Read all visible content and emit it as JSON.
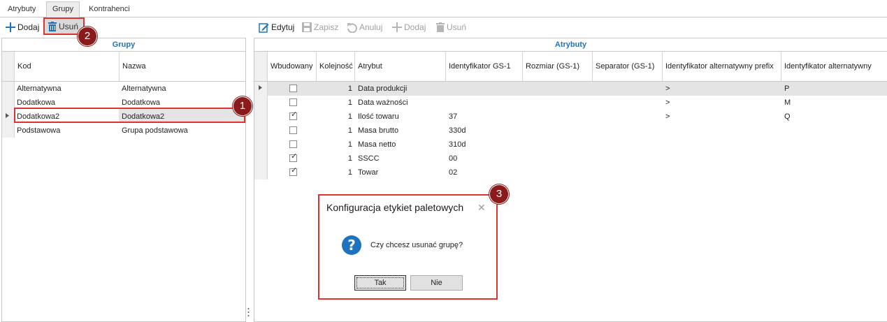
{
  "tabs": [
    "Atrybuty",
    "Grupy",
    "Kontrahenci"
  ],
  "left_toolbar": {
    "add": "Dodaj",
    "delete": "Usuń"
  },
  "right_toolbar": {
    "edit": "Edytuj",
    "save": "Zapisz",
    "cancel": "Anuluj",
    "add": "Dodaj",
    "delete": "Usuń"
  },
  "groups_panel": {
    "title": "Grupy",
    "columns": [
      "Kod",
      "Nazwa"
    ],
    "rows": [
      {
        "kod": "Alternatywna",
        "nazwa": "Alternatywna"
      },
      {
        "kod": "Dodatkowa",
        "nazwa": "Dodatkowa"
      },
      {
        "kod": "Dodatkowa2",
        "nazwa": "Dodatkowa2"
      },
      {
        "kod": "Podstawowa",
        "nazwa": "Grupa podstawowa"
      }
    ],
    "selected_index": 2
  },
  "attributes_panel": {
    "title": "Atrybuty",
    "columns": [
      "Wbudowany",
      "Kolejność",
      "Atrybut",
      "Identyfikator GS-1",
      "Rozmiar (GS-1)",
      "Separator (GS-1)",
      "Identyfikator alternatywny prefix",
      "Identyfikator alternatywny"
    ],
    "rows": [
      {
        "wbudowany": false,
        "kolejnosc": "1",
        "atrybut": "Data produkcji",
        "gs1": "",
        "rozmiar": "",
        "separator": "",
        "alt_prefix": ">",
        "alt": "P"
      },
      {
        "wbudowany": false,
        "kolejnosc": "1",
        "atrybut": "Data ważności",
        "gs1": "",
        "rozmiar": "",
        "separator": "",
        "alt_prefix": ">",
        "alt": "M"
      },
      {
        "wbudowany": true,
        "kolejnosc": "1",
        "atrybut": "Ilość towaru",
        "gs1": "37",
        "rozmiar": "",
        "separator": "",
        "alt_prefix": ">",
        "alt": "Q"
      },
      {
        "wbudowany": false,
        "kolejnosc": "1",
        "atrybut": "Masa brutto",
        "gs1": "330d",
        "rozmiar": "",
        "separator": "",
        "alt_prefix": "",
        "alt": ""
      },
      {
        "wbudowany": false,
        "kolejnosc": "1",
        "atrybut": "Masa netto",
        "gs1": "310d",
        "rozmiar": "",
        "separator": "",
        "alt_prefix": "",
        "alt": ""
      },
      {
        "wbudowany": true,
        "kolejnosc": "1",
        "atrybut": "SSCC",
        "gs1": "00",
        "rozmiar": "",
        "separator": "",
        "alt_prefix": "",
        "alt": ""
      },
      {
        "wbudowany": true,
        "kolejnosc": "1",
        "atrybut": "Towar",
        "gs1": "02",
        "rozmiar": "",
        "separator": "",
        "alt_prefix": "",
        "alt": ""
      }
    ]
  },
  "dialog": {
    "title": "Konfiguracja etykiet paletowych",
    "message": "Czy chcesz usunać grupę?",
    "yes": "Tak",
    "no": "Nie"
  },
  "badges": [
    "1",
    "2",
    "3"
  ],
  "colors": {
    "accent": "#1e73be",
    "highlight": "#e03030",
    "badge": "#8b1a1a",
    "selected_row": "#e4e4e4"
  }
}
